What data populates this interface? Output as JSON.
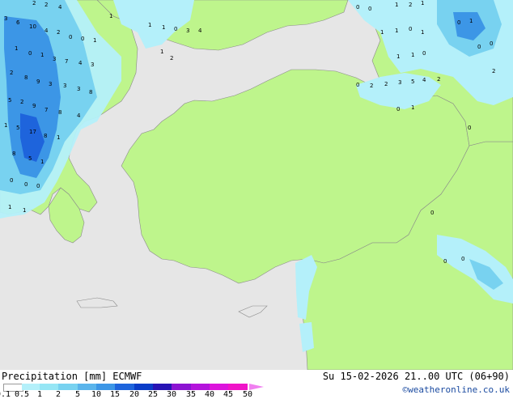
{
  "footer": {
    "title": "Precipitation [mm] ECMWF",
    "datetime": "Su 15-02-2026 21..00 UTC (06+90)",
    "credit": "©weatheronline.co.uk"
  },
  "legend": {
    "labels": [
      "0.1",
      "0.5",
      "1",
      "2",
      "5",
      "10",
      "15",
      "20",
      "25",
      "30",
      "35",
      "40",
      "45",
      "50"
    ],
    "colors": [
      "#ffffff",
      "#b4f0fa",
      "#96e6f5",
      "#78d2f0",
      "#5ab4eb",
      "#3c96e6",
      "#1e64dc",
      "#0a3cc8",
      "#2814b4",
      "#8c14d2",
      "#b414dc",
      "#dc14dc",
      "#f014c8",
      "#f080f0"
    ]
  },
  "colors": {
    "sea": "#e6e6e6",
    "land": "#bef58c",
    "precip_light": "#b4f0fa",
    "precip_medium": "#78d2f0",
    "precip_heavy": "#3c96e6",
    "precip_extreme": "#1e64dc"
  },
  "map_values": [
    "2",
    "2",
    "4",
    "3",
    "6",
    "10",
    "4",
    "2",
    "1",
    "0",
    "1",
    "3",
    "7",
    "4",
    "3",
    "2",
    "8",
    "9",
    "3",
    "3",
    "3",
    "8",
    "5",
    "2",
    "9",
    "7",
    "8",
    "4",
    "1",
    "5",
    "17",
    "8",
    "1",
    "8",
    "5",
    "1",
    "0",
    "0",
    "0",
    "1",
    "1",
    "0",
    "0",
    "1",
    "1",
    "1",
    "1",
    "0",
    "3",
    "4",
    "1",
    "2",
    "0",
    "0",
    "1",
    "2",
    "1",
    "1",
    "1",
    "0",
    "1",
    "1",
    "1",
    "0",
    "0",
    "2",
    "2",
    "3",
    "5",
    "4",
    "2",
    "0",
    "1",
    "0",
    "1",
    "0",
    "0",
    "2",
    "0",
    "0",
    "0",
    "0"
  ]
}
